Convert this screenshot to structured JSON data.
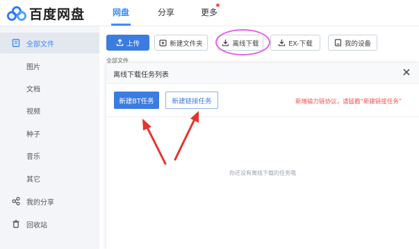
{
  "app": {
    "logo_text": "百度网盘",
    "brand_color": "#3b8cff"
  },
  "nav": {
    "tabs": [
      {
        "label": "网盘",
        "active": true
      },
      {
        "label": "分享",
        "active": false
      },
      {
        "label": "更多",
        "active": false,
        "badge_dot": true
      }
    ]
  },
  "sidebar": {
    "items": [
      {
        "label": "全部文件",
        "icon": "file-list-icon",
        "active": true
      },
      {
        "label": "图片"
      },
      {
        "label": "文档"
      },
      {
        "label": "视频"
      },
      {
        "label": "种子"
      },
      {
        "label": "音乐"
      },
      {
        "label": "其它"
      },
      {
        "label": "我的分享",
        "icon": "share-icon"
      },
      {
        "label": "回收站",
        "icon": "trash-icon"
      }
    ]
  },
  "toolbar": {
    "upload": "上传",
    "new_folder": "新建文件夹",
    "offline_download": "离线下载",
    "ex_download": "EX-下载",
    "my_devices": "我的设备"
  },
  "breadcrumb": "全部文件",
  "modal": {
    "title": "离线下载任务列表",
    "new_bt_task": "新建BT任务",
    "new_link_task": "新建链接任务",
    "notice": "新增磁力链协议，请猛戳“新建链接任务”",
    "empty_text": "你还没有离线下载的任务哦"
  },
  "colors": {
    "primary_button": "#3b7ce0",
    "notice_red": "#ff4b4b",
    "annotation_circle": "#e45ee8",
    "annotation_arrow": "#e8322b"
  }
}
